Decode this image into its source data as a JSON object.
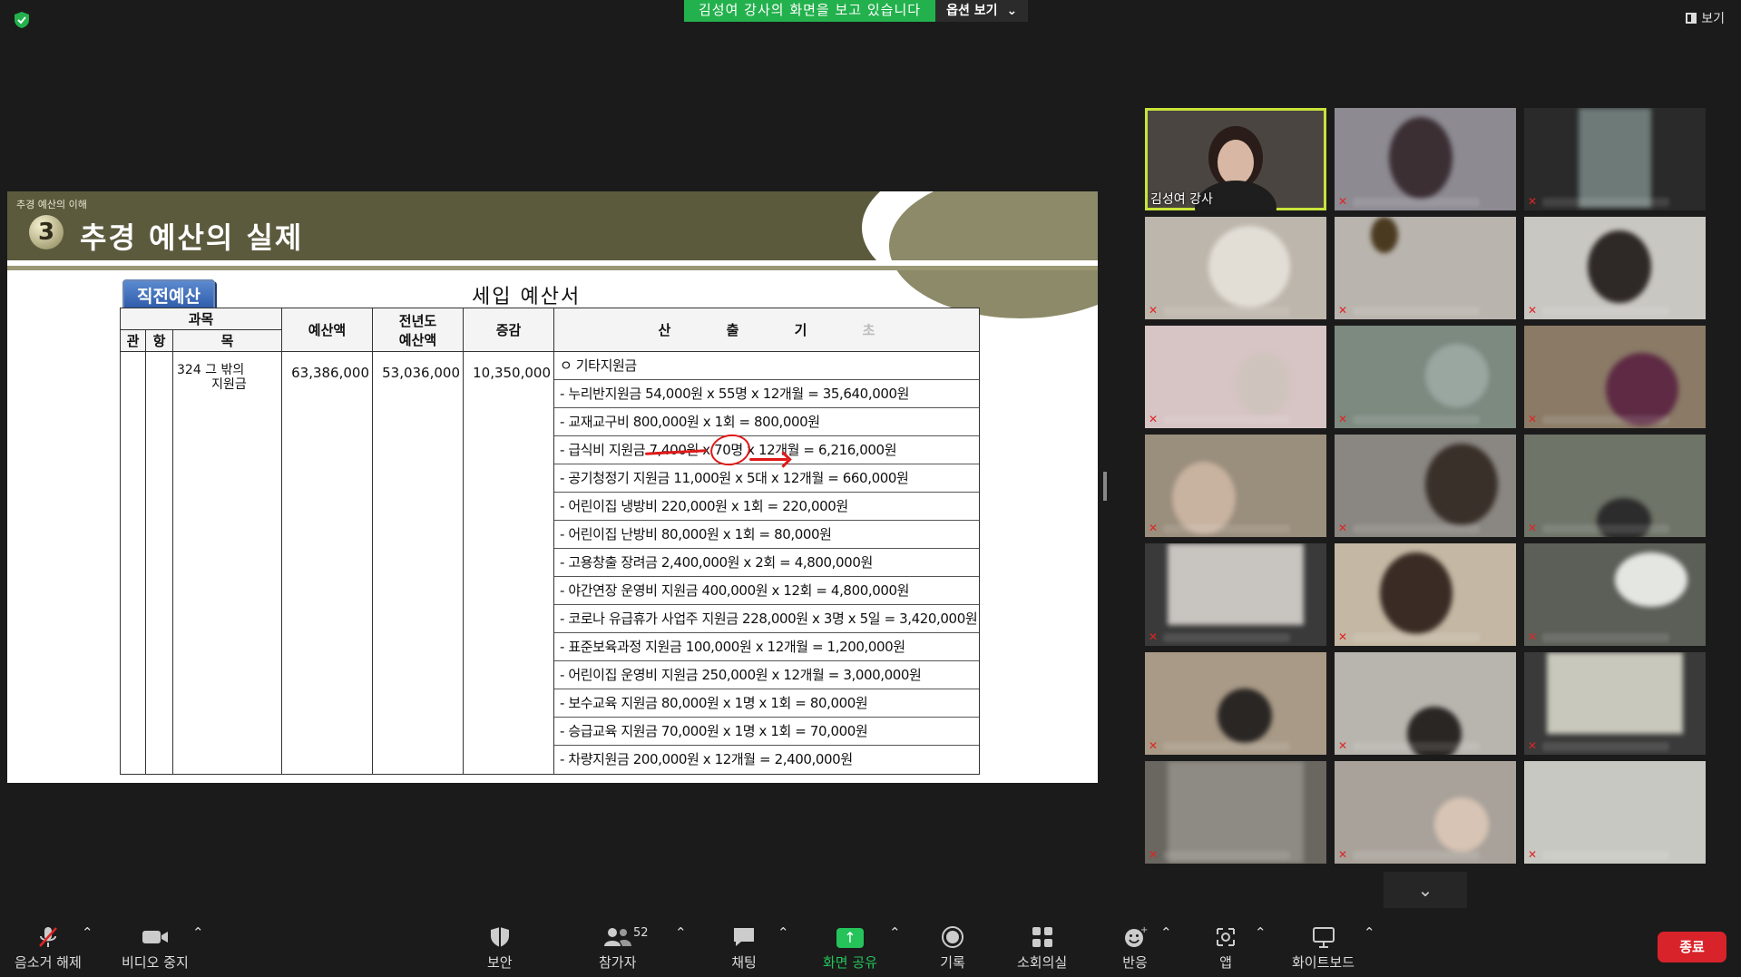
{
  "banner": {
    "sharing_text": "김성여 강사의 화면을 보고 있습니다",
    "options_label": "옵션 보기",
    "options_caret": "⌄"
  },
  "view_label": "보기",
  "slide": {
    "subtitle": "추경 예산의 이해",
    "number": "3",
    "title": "추경 예산의 실제",
    "tag": "직전예산",
    "doc_title": "세입 예산서",
    "headers": {
      "gwamok": "과목",
      "gwan": "관",
      "hang": "항",
      "mok": "목",
      "budget": "예산액",
      "prev_budget_1": "전년도",
      "prev_budget_2": "예산액",
      "change": "증감",
      "calc_1": "산",
      "calc_2": "출",
      "calc_3": "기",
      "calc_4": "초"
    },
    "mok_1": "324 그 밖의",
    "mok_2": "지원금",
    "budget": "63,386,000",
    "prev_budget": "53,036,000",
    "change": "10,350,000",
    "calc_rows": [
      "ㅇ 기타지원금",
      "- 누리반지원금 54,000원 x 55명 x 12개월 = 35,640,000원",
      "- 교재교구비 800,000원 x 1회 = 800,000원",
      "- 급식비 지원금 7,400원 x 70명 x 12개월 = 6,216,000원",
      "- 공기청정기 지원금 11,000원 x 5대 x 12개월 = 660,000원",
      "- 어린이집 냉방비 220,000원 x 1회 = 220,000원",
      "- 어린이집 난방비 80,000원 x 1회 = 80,000원",
      "- 고용창출 장려금 2,400,000원 x 2회 = 4,800,000원",
      "- 야간연장 운영비 지원금 400,000원 x 12회 = 4,800,000원",
      "- 코로나 유급휴가 사업주 지원금 228,000원 x 3명 x 5일 = 3,420,000원",
      "- 표준보육과정 지원금 100,000원 x 12개월 = 1,200,000원",
      "- 어린이집 운영비 지원금 250,000원 x 12개월 = 3,000,000원",
      "- 보수교육 지원금 80,000원 x 1명 x 1회 = 80,000원",
      "- 승급교육 지원금 70,000원 x 1명 x 1회 = 70,000원",
      "- 차량지원금 200,000원 x 12개월 = 2,400,000원"
    ]
  },
  "gallery": {
    "active_name": "김성여 강사",
    "scroll_icon": "⌄"
  },
  "toolbar": {
    "mute_label": "음소거 해제",
    "video_label": "비디오 중지",
    "security_label": "보안",
    "participants_label": "참가자",
    "participants_count": "52",
    "chat_label": "채팅",
    "share_label": "화면 공유",
    "record_label": "기록",
    "breakout_label": "소회의실",
    "reactions_label": "반응",
    "apps_label": "앱",
    "whiteboard_label": "화이트보드",
    "end_label": "종료"
  },
  "colors": {
    "accent_green": "#23b14d",
    "active_tile": "#c9e33a",
    "end_red": "#d8232a",
    "slide_header": "#5c5a3d"
  }
}
